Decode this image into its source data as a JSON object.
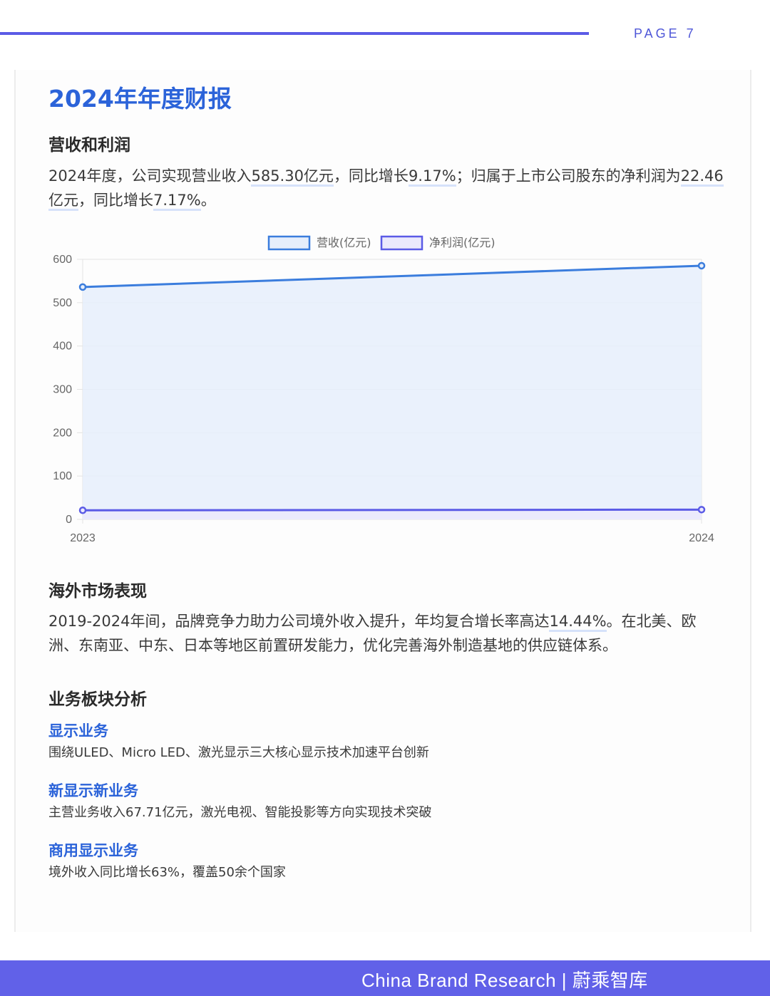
{
  "header": {
    "page": "PAGE 7"
  },
  "title": "2024年年度财报",
  "sections": {
    "revenue": {
      "heading": "营收和利润",
      "p1": "2024年度，公司实现营业收入",
      "v1": "585.30亿元",
      "p2": "，同比增长",
      "v2": "9.17%",
      "p3": "；归属于上市公司股东的净利润为",
      "v3": "22.46亿元",
      "p4": "，同比增长",
      "v4": "7.17%",
      "p5": "。"
    },
    "overseas": {
      "heading": "海外市场表现",
      "p1": "2019-2024年间，品牌竞争力助力公司境外收入提升，年均复合增长率高达",
      "v1": "14.44%",
      "p2": "。在北美、欧洲、东南亚、中东、日本等地区前置研发能力，优化完善海外制造基地的供应链体系。"
    },
    "segments": {
      "heading": "业务板块分析",
      "items": [
        {
          "name": "显示业务",
          "desc": "围绕ULED、Micro LED、激光显示三大核心显示技术加速平台创新"
        },
        {
          "name": "新显示新业务",
          "desc": "主营业务收入67.71亿元，激光电视、智能投影等方向实现技术突破"
        },
        {
          "name": "商用显示业务",
          "desc": "境外收入同比增长63%，覆盖50余个国家"
        }
      ]
    }
  },
  "chart_data": {
    "type": "line",
    "categories": [
      "2023",
      "2024"
    ],
    "series": [
      {
        "name": "营收(亿元)",
        "values": [
          536.1,
          585.3
        ],
        "color": "#3b7ddd",
        "fill": "#e6eefb"
      },
      {
        "name": "净利润(亿元)",
        "values": [
          20.96,
          22.46
        ],
        "color": "#5b5be6",
        "fill": "#ebe9fc"
      }
    ],
    "ylim": [
      0,
      600
    ],
    "yticks": [
      0,
      100,
      200,
      300,
      400,
      500,
      600
    ],
    "grid": true,
    "legend": "top-center"
  },
  "footer": {
    "text": "China Brand Research | 蔚乘智库"
  }
}
